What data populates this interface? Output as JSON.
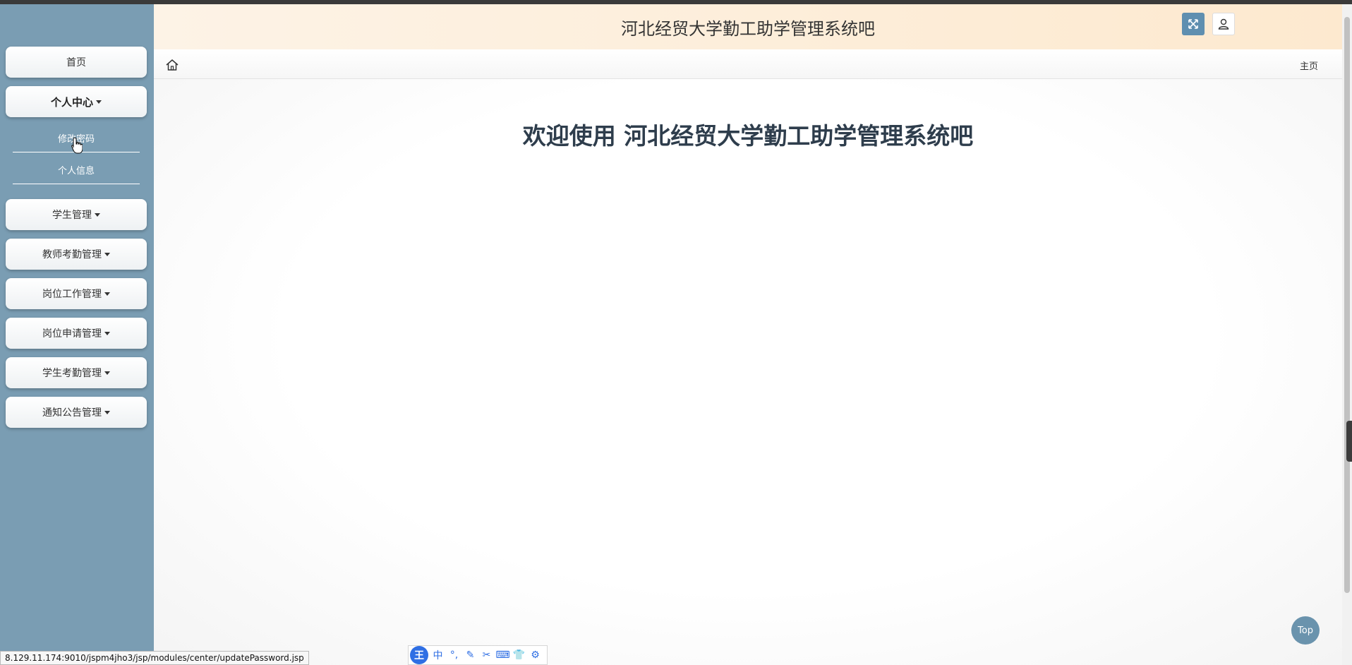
{
  "app": {
    "title": "河北经贸大学勤工助学管理系统吧"
  },
  "sidebar": {
    "home_label": "首页",
    "personal_center_label": "个人中心",
    "sub_items": [
      "修改密码",
      "个人信息"
    ],
    "menus": [
      "学生管理",
      "教师考勤管理",
      "岗位工作管理",
      "岗位申请管理",
      "学生考勤管理",
      "通知公告管理"
    ]
  },
  "breadcrumb": {
    "current": "主页"
  },
  "main": {
    "welcome": "欢迎使用 河北经贸大学勤工助学管理系统吧"
  },
  "top_button": "Top",
  "status_bar": {
    "url": "8.129.11.174:9010/jspm4jho3/jsp/modules/center/updatePassword.jsp"
  },
  "ime": {
    "logo": "王",
    "items": [
      "中",
      "°,",
      "✎",
      "✂",
      "⌨",
      "👕",
      "⚙"
    ]
  },
  "colors": {
    "sidebar_bg": "#7a9db3",
    "header_bg": "#fde9cf",
    "accent": "#5f8fb0",
    "title_text": "#2e3d4c"
  },
  "icons": [
    "home-icon",
    "expand-icon",
    "user-icon",
    "cursor-icon"
  ]
}
